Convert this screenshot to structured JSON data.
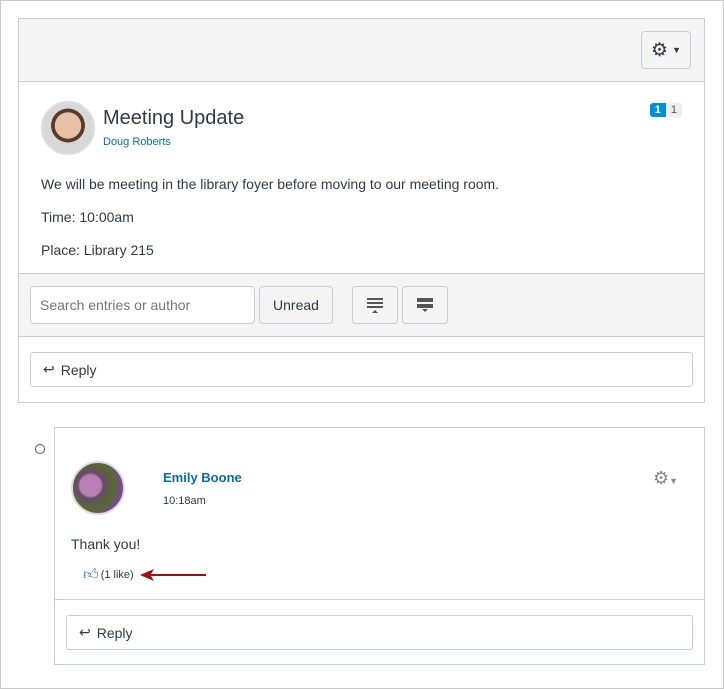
{
  "topic": {
    "title": "Meeting Update",
    "author": "Doug Roberts",
    "unread_badge": "1",
    "total_badge": "1",
    "body": [
      "We will be meeting in the library foyer before moving to our meeting room.",
      "Time: 10:00am",
      "Place: Library 215"
    ]
  },
  "toolbar": {
    "search_placeholder": "Search entries or author",
    "unread_label": "Unread"
  },
  "reply_label": "Reply",
  "entry": {
    "author": "Emily Boone",
    "time": "10:18am",
    "message": "Thank you!",
    "likes": "(1 like)",
    "reply_label": "Reply"
  },
  "colors": {
    "link": "#0770a3",
    "arrow": "#9b0f0f",
    "like": "#1e73be"
  }
}
